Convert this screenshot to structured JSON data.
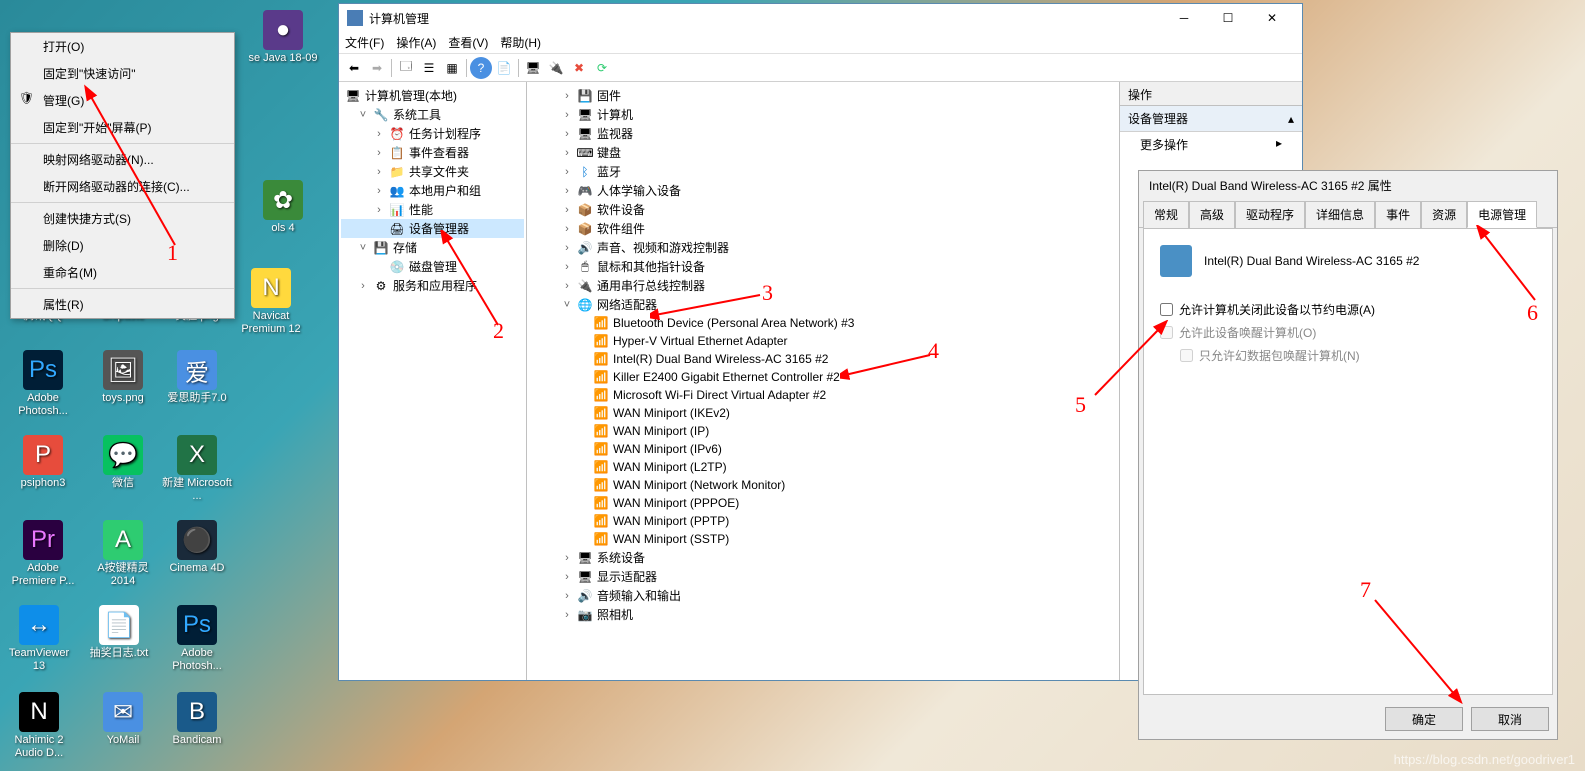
{
  "context_menu": {
    "open": "打开(O)",
    "pin_quick": "固定到\"快速访问\"",
    "manage": "管理(G)",
    "pin_start": "固定到\"开始\"屏幕(P)",
    "map_drive": "映射网络驱动器(N)...",
    "disconnect": "断开网络驱动器的连接(C)...",
    "shortcut": "创建快捷方式(S)",
    "delete": "删除(D)",
    "rename": "重命名(M)",
    "properties": "属性(R)"
  },
  "desktop": {
    "i1": "se Java\n18-09",
    "i2": "ols 4",
    "i3": "腾讯QQ",
    "i4": "Snipaste",
    "i5": "笑脸.png",
    "i6": "Navicat Premium 12",
    "i7": "Adobe Photosh...",
    "i8": "toys.png",
    "i9": "爱思助手7.0",
    "i10": "psiphon3",
    "i11": "微信",
    "i12": "新建 Microsoft ...",
    "i13": "Adobe Premiere P...",
    "i14": "A按键精灵2014",
    "i15": "Cinema 4D",
    "i16": "TeamViewer 13",
    "i17": "抽奖日志.txt",
    "i18": "Adobe Photosh...",
    "i19": "Nahimic 2 Audio D...",
    "i20": "YoMail",
    "i21": "Bandicam"
  },
  "mgmt": {
    "title": "计算机管理",
    "menu": {
      "file": "文件(F)",
      "action": "操作(A)",
      "view": "查看(V)",
      "help": "帮助(H)"
    },
    "left": {
      "root": "计算机管理(本地)",
      "systools": "系统工具",
      "tasksched": "任务计划程序",
      "eventvwr": "事件查看器",
      "shared": "共享文件夹",
      "localusers": "本地用户和组",
      "perf": "性能",
      "devmgr": "设备管理器",
      "storage": "存储",
      "diskmgr": "磁盘管理",
      "services": "服务和应用程序"
    },
    "center": {
      "firmware": "固件",
      "computer": "计算机",
      "monitors": "监视器",
      "keyboards": "键盘",
      "bluetooth": "蓝牙",
      "hid": "人体学输入设备",
      "softdev": "软件设备",
      "softcomp": "软件组件",
      "sound": "声音、视频和游戏控制器",
      "mouse": "鼠标和其他指针设备",
      "usb": "通用串行总线控制器",
      "netadapt": "网络适配器",
      "na1": "Bluetooth Device (Personal Area Network) #3",
      "na2": "Hyper-V Virtual Ethernet Adapter",
      "na3": "Intel(R) Dual Band Wireless-AC 3165 #2",
      "na4": "Killer E2400 Gigabit Ethernet Controller #2",
      "na5": "Microsoft Wi-Fi Direct Virtual Adapter #2",
      "na6": "WAN Miniport (IKEv2)",
      "na7": "WAN Miniport (IP)",
      "na8": "WAN Miniport (IPv6)",
      "na9": "WAN Miniport (L2TP)",
      "na10": "WAN Miniport (Network Monitor)",
      "na11": "WAN Miniport (PPPOE)",
      "na12": "WAN Miniport (PPTP)",
      "na13": "WAN Miniport (SSTP)",
      "sysdev": "系统设备",
      "displayad": "显示适配器",
      "audio": "音频输入和输出",
      "camera": "照相机"
    },
    "right": {
      "head": "操作",
      "section": "设备管理器",
      "more": "更多操作"
    }
  },
  "props": {
    "title": "Intel(R) Dual Band Wireless-AC 3165 #2 属性",
    "tabs": {
      "general": "常规",
      "advanced": "高级",
      "driver": "驱动程序",
      "details": "详细信息",
      "events": "事件",
      "resources": "资源",
      "power": "电源管理"
    },
    "device_name": "Intel(R) Dual Band Wireless-AC 3165 #2",
    "cb1": "允许计算机关闭此设备以节约电源(A)",
    "cb2": "允许此设备唤醒计算机(O)",
    "cb3": "只允许幻数据包唤醒计算机(N)",
    "ok": "确定",
    "cancel": "取消"
  },
  "annotations": {
    "n1": "1",
    "n2": "2",
    "n3": "3",
    "n4": "4",
    "n5": "5",
    "n6": "6",
    "n7": "7"
  },
  "watermark": "https://blog.csdn.net/goodriver1"
}
